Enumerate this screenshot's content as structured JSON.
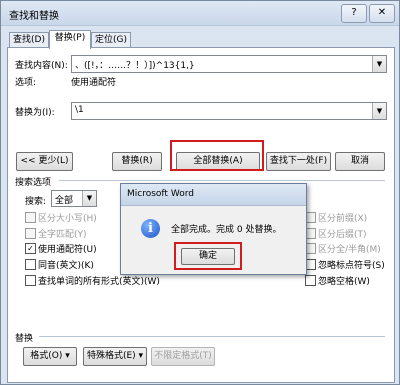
{
  "window": {
    "title": "查找和替换",
    "help_glyph": "?",
    "close_glyph": "✕"
  },
  "tabs": [
    "查找(D)",
    "替换(P)",
    "定位(G)"
  ],
  "find": {
    "label": "查找内容(N):",
    "value": "、([!，：……？！）])^13{1,}",
    "options_label": "选项:",
    "options_value": "使用通配符"
  },
  "replace": {
    "label": "替换为(I):",
    "value": "\\1"
  },
  "buttons": {
    "less": "<< 更少(L)",
    "replace": "替换(R)",
    "replace_all": "全部替换(A)",
    "find_next": "查找下一处(F)",
    "cancel": "取消"
  },
  "search_options": {
    "header": "搜索选项",
    "search_label": "搜索:",
    "search_value": "全部",
    "left": [
      {
        "label": "区分大小写(H)",
        "checked": false,
        "disabled": true
      },
      {
        "label": "全字匹配(Y)",
        "checked": false,
        "disabled": true
      },
      {
        "label": "使用通配符(U)",
        "checked": true,
        "disabled": false
      },
      {
        "label": "同音(英文)(K)",
        "checked": false,
        "disabled": false
      },
      {
        "label": "查找单词的所有形式(英文)(W)",
        "checked": false,
        "disabled": false
      }
    ],
    "right": [
      {
        "label": "区分前缀(X)",
        "checked": false,
        "disabled": true
      },
      {
        "label": "区分后缀(T)",
        "checked": false,
        "disabled": true
      },
      {
        "label": "区分全/半角(M)",
        "checked": false,
        "disabled": true
      },
      {
        "label": "忽略标点符号(S)",
        "checked": false,
        "disabled": false
      },
      {
        "label": "忽略空格(W)",
        "checked": false,
        "disabled": false
      }
    ]
  },
  "replace_section": {
    "header": "替换",
    "format_btn": "格式(O) ▾",
    "special_btn": "特殊格式(E) ▾",
    "no_format_btn": "不限定格式(T)"
  },
  "message_box": {
    "title": "Microsoft Word",
    "text": "全部完成。完成 0 处替换。",
    "ok": "确定",
    "icon": "information-icon"
  },
  "colors": {
    "highlight": "#d21c1c",
    "titlebar": "#c9d7ea",
    "info_icon": "#1d55c4"
  }
}
